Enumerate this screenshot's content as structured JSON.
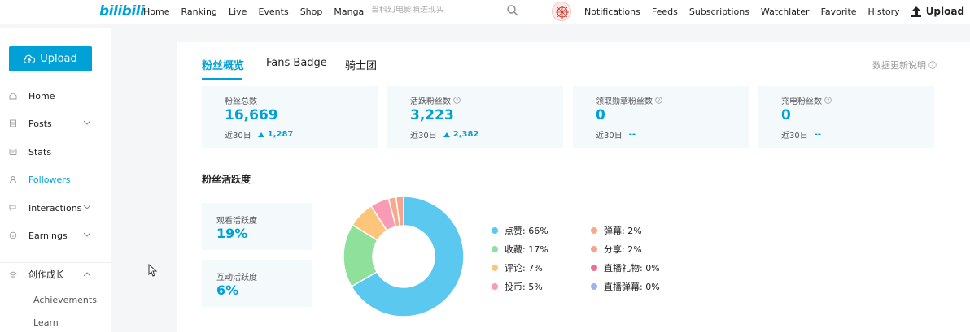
{
  "header": {
    "logo": "bilibili",
    "nav_left": [
      "Home",
      "Ranking",
      "Live",
      "Events",
      "Shop",
      "Manga"
    ],
    "search_placeholder": "当科幻电影照进现实",
    "nav_right": [
      "Notifications",
      "Feeds",
      "Subscriptions",
      "Watchlater",
      "Favorite",
      "History"
    ],
    "upload_label": "Upload"
  },
  "sidebar": {
    "upload_label": "Upload",
    "items": [
      {
        "label": "Home",
        "icon": "home-icon"
      },
      {
        "label": "Posts",
        "icon": "posts-icon",
        "chevron": "down"
      },
      {
        "label": "Stats",
        "icon": "stats-icon"
      },
      {
        "label": "Followers",
        "icon": "followers-icon",
        "active": true
      },
      {
        "label": "Interactions",
        "icon": "interactions-icon",
        "chevron": "down"
      },
      {
        "label": "Earnings",
        "icon": "earnings-icon",
        "chevron": "down"
      },
      {
        "label": "创作成长",
        "icon": "growth-icon",
        "chevron": "up"
      }
    ],
    "subitems": [
      "Achievements",
      "Learn"
    ]
  },
  "tabs": [
    "粉丝概览",
    "Fans Badge",
    "骑士团"
  ],
  "update_note": "数据更新说明",
  "stats": [
    {
      "label": "粉丝总数",
      "value": "16,669",
      "period": "近30日",
      "delta": "1,287",
      "help": false
    },
    {
      "label": "活跃粉丝数",
      "value": "3,223",
      "period": "近30日",
      "delta": "2,382",
      "help": true
    },
    {
      "label": "领取勋章粉丝数",
      "value": "0",
      "period": "近30日",
      "delta": "--",
      "help": true
    },
    {
      "label": "充电粉丝数",
      "value": "0",
      "period": "近30日",
      "delta": "--",
      "help": true
    }
  ],
  "activity": {
    "title": "粉丝活跃度",
    "boxes": [
      {
        "label": "观看活跃度",
        "value": "19%"
      },
      {
        "label": "互动活跃度",
        "value": "6%"
      }
    ]
  },
  "chart_data": {
    "type": "pie",
    "donut": true,
    "categories": [
      "点赞",
      "收藏",
      "评论",
      "投币",
      "弹幕",
      "分享",
      "直播礼物",
      "直播弹幕"
    ],
    "values": [
      66,
      17,
      7,
      5,
      2,
      2,
      0,
      0
    ],
    "legend_text": [
      "点赞: 66%",
      "收藏: 17%",
      "评论: 7%",
      "投币: 5%",
      "弹幕: 2%",
      "分享: 2%",
      "直播礼物: 0%",
      "直播弹幕: 0%"
    ],
    "colors": [
      "#5bc8ef",
      "#8ee09a",
      "#fcc57a",
      "#f99bb4",
      "#f8a98a",
      "#f4a38f",
      "#ee6f8f",
      "#9fb3f0"
    ],
    "legend_placement": "right"
  },
  "colors": {
    "accent": "#00a1d6"
  }
}
